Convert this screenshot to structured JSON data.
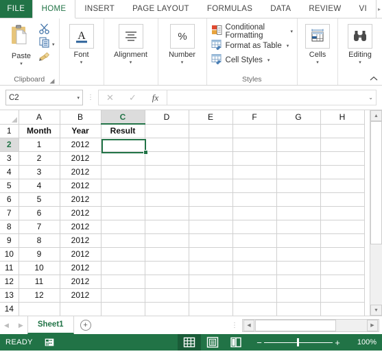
{
  "ribbon": {
    "file_tab": "FILE",
    "tabs": [
      {
        "label": "HOME",
        "active": true
      },
      {
        "label": "INSERT",
        "active": false
      },
      {
        "label": "PAGE LAYOUT",
        "active": false
      },
      {
        "label": "FORMULAS",
        "active": false
      },
      {
        "label": "DATA",
        "active": false
      },
      {
        "label": "REVIEW",
        "active": false
      },
      {
        "label": "VI",
        "active": false
      }
    ],
    "overflow_arrow": "▸",
    "groups": {
      "clipboard": {
        "label": "Clipboard",
        "paste_label": "Paste",
        "cut_name": "cut-button",
        "copy_name": "copy-button",
        "format_painter_name": "format-painter-button"
      },
      "font": {
        "label": "Font",
        "glyph": "A"
      },
      "alignment": {
        "label": "Alignment"
      },
      "number": {
        "label": "Number",
        "glyph": "%"
      },
      "styles": {
        "label": "Styles",
        "items": [
          {
            "label": "Conditional Formatting",
            "caret": "▾"
          },
          {
            "label": "Format as Table",
            "caret": "▾"
          },
          {
            "label": "Cell Styles",
            "caret": "▾"
          }
        ]
      },
      "cells": {
        "label": "Cells"
      },
      "editing": {
        "label": "Editing"
      }
    },
    "collapse_arrow": "⌃",
    "caret": "▾"
  },
  "formula_bar": {
    "name_box_value": "C2",
    "name_box_caret": "▾",
    "cancel_glyph": "✕",
    "enter_glyph": "✓",
    "fx_glyph": "fx",
    "input_value": "",
    "expand_caret": "⌄"
  },
  "grid": {
    "columns": [
      "A",
      "B",
      "C",
      "D",
      "E",
      "F",
      "G",
      "H"
    ],
    "selected_column": "C",
    "selected_row": "2",
    "selected_cell": "C2",
    "rows": [
      {
        "num": "1",
        "cells": [
          "Month",
          "Year",
          "Result",
          "",
          "",
          "",
          "",
          ""
        ],
        "header": true
      },
      {
        "num": "2",
        "cells": [
          "1",
          "2012",
          "",
          "",
          "",
          "",
          "",
          ""
        ],
        "header": false
      },
      {
        "num": "3",
        "cells": [
          "2",
          "2012",
          "",
          "",
          "",
          "",
          "",
          ""
        ],
        "header": false
      },
      {
        "num": "4",
        "cells": [
          "3",
          "2012",
          "",
          "",
          "",
          "",
          "",
          ""
        ],
        "header": false
      },
      {
        "num": "5",
        "cells": [
          "4",
          "2012",
          "",
          "",
          "",
          "",
          "",
          ""
        ],
        "header": false
      },
      {
        "num": "6",
        "cells": [
          "5",
          "2012",
          "",
          "",
          "",
          "",
          "",
          ""
        ],
        "header": false
      },
      {
        "num": "7",
        "cells": [
          "6",
          "2012",
          "",
          "",
          "",
          "",
          "",
          ""
        ],
        "header": false
      },
      {
        "num": "8",
        "cells": [
          "7",
          "2012",
          "",
          "",
          "",
          "",
          "",
          ""
        ],
        "header": false
      },
      {
        "num": "9",
        "cells": [
          "8",
          "2012",
          "",
          "",
          "",
          "",
          "",
          ""
        ],
        "header": false
      },
      {
        "num": "10",
        "cells": [
          "9",
          "2012",
          "",
          "",
          "",
          "",
          "",
          ""
        ],
        "header": false
      },
      {
        "num": "11",
        "cells": [
          "10",
          "2012",
          "",
          "",
          "",
          "",
          "",
          ""
        ],
        "header": false
      },
      {
        "num": "12",
        "cells": [
          "11",
          "2012",
          "",
          "",
          "",
          "",
          "",
          ""
        ],
        "header": false
      },
      {
        "num": "13",
        "cells": [
          "12",
          "2012",
          "",
          "",
          "",
          "",
          "",
          ""
        ],
        "header": false
      },
      {
        "num": "14",
        "cells": [
          "",
          "",
          "",
          "",
          "",
          "",
          "",
          ""
        ],
        "header": false
      }
    ]
  },
  "sheet_tabs": {
    "prev_glyph": "◀",
    "next_glyph": "▶",
    "tabs": [
      {
        "label": "Sheet1",
        "active": true
      }
    ],
    "new_sheet_glyph": "+",
    "dots": "⋮",
    "hscroll_left": "◀",
    "hscroll_right": "▶"
  },
  "status_bar": {
    "state": "READY",
    "views": [
      {
        "name": "normal-view",
        "active": true
      },
      {
        "name": "page-layout-view",
        "active": false
      },
      {
        "name": "page-break-preview",
        "active": false
      }
    ],
    "zoom_out": "−",
    "zoom_in": "+",
    "zoom_level": "100%"
  },
  "scrollbars": {
    "v_up": "▲",
    "v_down": "▼"
  },
  "colors": {
    "excel_green": "#217346",
    "selection_green": "#217346",
    "header_gray": "#dcdcdc",
    "grid_line": "#d0d0d0"
  }
}
